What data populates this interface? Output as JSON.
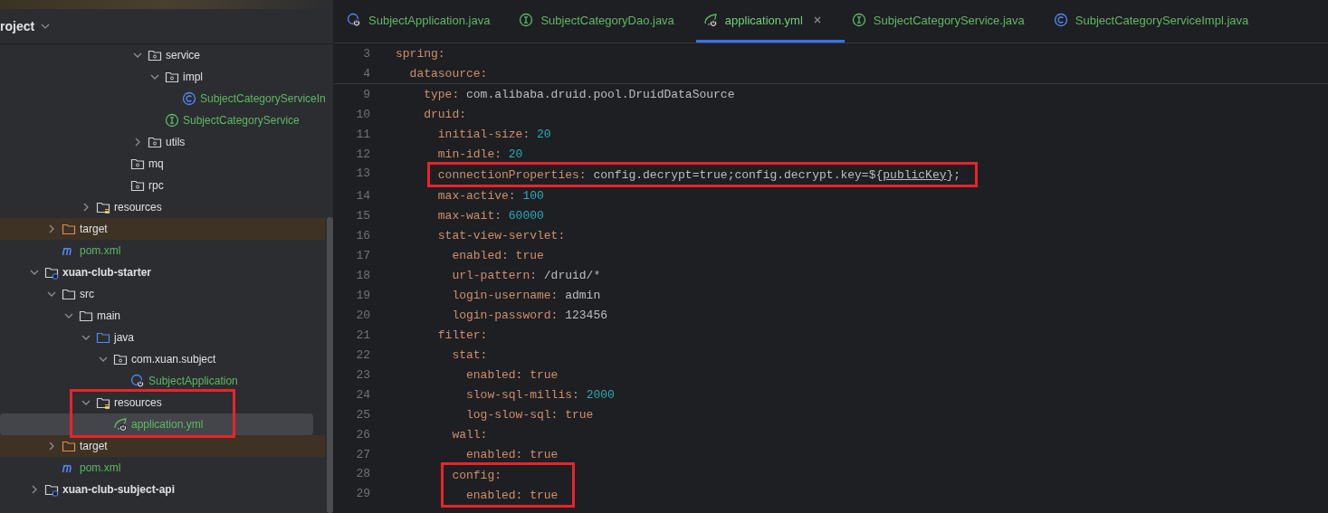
{
  "sidebar": {
    "title": "roject",
    "tree": [
      {
        "children": [
          {
            "children": [
              {
                "children": [
                  {
                    "children": [
                      {
                        "children": [
                          {
                            "children": [
                              {
                                "label": "service",
                                "kind": "package",
                                "expanded": true,
                                "selected": false,
                                "children": [
                                  {
                                    "label": "impl",
                                    "kind": "package",
                                    "expanded": true,
                                    "selected": false,
                                    "children": [
                                      {
                                        "label": "SubjectCategoryServiceIn",
                                        "kind": "class",
                                        "color": "#5fb865",
                                        "selected": false
                                      }
                                    ]
                                  },
                                  {
                                    "label": "SubjectCategoryService",
                                    "kind": "interface",
                                    "color": "#5fb865",
                                    "selected": false
                                  }
                                ]
                              },
                              {
                                "label": "utils",
                                "kind": "package",
                                "expanded": false,
                                "selected": false
                              }
                            ]
                          },
                          {
                            "label": "mq",
                            "kind": "package",
                            "selected": false
                          },
                          {
                            "label": "rpc",
                            "kind": "package",
                            "selected": false
                          }
                        ]
                      }
                    ]
                  },
                  {
                    "label": "resources",
                    "kind": "resources",
                    "expanded": false,
                    "selected": false
                  }
                ]
              }
            ]
          },
          {
            "label": "target",
            "kind": "excluded",
            "expanded": false,
            "selected": false
          },
          {
            "label": "pom.xml",
            "kind": "maven",
            "color": "#5fb865",
            "selected": false
          }
        ]
      },
      {
        "label": "xuan-club-starter",
        "kind": "module",
        "expanded": true,
        "selected": false,
        "children": [
          {
            "label": "src",
            "kind": "folder",
            "expanded": true,
            "selected": false,
            "children": [
              {
                "label": "main",
                "kind": "folder",
                "expanded": true,
                "selected": false,
                "children": [
                  {
                    "label": "java",
                    "kind": "source",
                    "expanded": true,
                    "selected": false,
                    "children": [
                      {
                        "label": "com.xuan.subject",
                        "kind": "package",
                        "expanded": true,
                        "selected": false,
                        "children": [
                          {
                            "label": "SubjectApplication",
                            "kind": "spring-app",
                            "color": "#5fb865",
                            "selected": false
                          }
                        ]
                      }
                    ]
                  },
                  {
                    "label": "resources",
                    "kind": "resources",
                    "expanded": true,
                    "selected": false,
                    "annotated": true,
                    "children": [
                      {
                        "label": "application.yml",
                        "kind": "yml",
                        "color": "#5fb865",
                        "selected": true,
                        "annotated": true
                      }
                    ]
                  }
                ]
              }
            ]
          },
          {
            "label": "target",
            "kind": "excluded",
            "expanded": false,
            "selected": false
          },
          {
            "label": "pom.xml",
            "kind": "maven",
            "color": "#5fb865",
            "selected": false
          }
        ]
      },
      {
        "label": "xuan-club-subject-api",
        "kind": "module",
        "expanded": false,
        "selected": false
      }
    ]
  },
  "tabs": [
    {
      "label": "SubjectApplication.java",
      "kind": "spring-app",
      "selected": false
    },
    {
      "label": "SubjectCategoryDao.java",
      "kind": "interface",
      "selected": false
    },
    {
      "label": "application.yml",
      "kind": "yml",
      "selected": true
    },
    {
      "label": "SubjectCategoryService.java",
      "kind": "interface",
      "selected": false
    },
    {
      "label": "SubjectCategoryServiceImpl.java",
      "kind": "class",
      "selected": false
    }
  ],
  "editor": {
    "lines": [
      {
        "number": "3",
        "key": "spring:",
        "sticky": true,
        "children": [
          {
            "number": "4",
            "key": "datasource:",
            "sticky": true,
            "children": [
              {
                "number": "9",
                "key": "type:",
                "value": [
                  {
                    "text": "com.alibaba.druid.pool.DruidDataSource",
                    "kind": "plain"
                  }
                ]
              },
              {
                "number": "10",
                "key": "druid:",
                "children": [
                  {
                    "number": "11",
                    "key": "initial-size:",
                    "value": [
                      {
                        "text": "20",
                        "kind": "number"
                      }
                    ]
                  },
                  {
                    "number": "12",
                    "key": "min-idle:",
                    "value": [
                      {
                        "text": "20",
                        "kind": "number"
                      }
                    ]
                  },
                  {
                    "number": "13",
                    "key": "connectionProperties:",
                    "annotated": true,
                    "value": [
                      {
                        "text": "config.decrypt=true;config.decrypt.key=${",
                        "kind": "plain"
                      },
                      {
                        "text": "publicKey",
                        "kind": "reference"
                      },
                      {
                        "text": "};",
                        "kind": "plain"
                      }
                    ]
                  },
                  {
                    "number": "14",
                    "key": "max-active:",
                    "value": [
                      {
                        "text": "100",
                        "kind": "number"
                      }
                    ]
                  },
                  {
                    "number": "15",
                    "key": "max-wait:",
                    "value": [
                      {
                        "text": "60000",
                        "kind": "number"
                      }
                    ]
                  },
                  {
                    "number": "16",
                    "key": "stat-view-servlet:",
                    "children": [
                      {
                        "number": "17",
                        "key": "enabled:",
                        "value": [
                          {
                            "text": "true",
                            "kind": "keyword"
                          }
                        ]
                      },
                      {
                        "number": "18",
                        "key": "url-pattern:",
                        "value": [
                          {
                            "text": "/druid/*",
                            "kind": "plain"
                          }
                        ]
                      },
                      {
                        "number": "19",
                        "key": "login-username:",
                        "value": [
                          {
                            "text": "admin",
                            "kind": "plain"
                          }
                        ]
                      },
                      {
                        "number": "20",
                        "key": "login-password:",
                        "value": [
                          {
                            "text": "123456",
                            "kind": "plain"
                          }
                        ]
                      }
                    ]
                  },
                  {
                    "number": "21",
                    "key": "filter:",
                    "children": [
                      {
                        "number": "22",
                        "key": "stat:",
                        "children": [
                          {
                            "number": "23",
                            "key": "enabled:",
                            "value": [
                              {
                                "text": "true",
                                "kind": "keyword"
                              }
                            ]
                          },
                          {
                            "number": "24",
                            "key": "slow-sql-millis:",
                            "value": [
                              {
                                "text": "2000",
                                "kind": "number"
                              }
                            ]
                          },
                          {
                            "number": "25",
                            "key": "log-slow-sql:",
                            "value": [
                              {
                                "text": "true",
                                "kind": "keyword"
                              }
                            ]
                          }
                        ]
                      },
                      {
                        "number": "26",
                        "key": "wall:",
                        "children": [
                          {
                            "number": "27",
                            "key": "enabled:",
                            "value": [
                              {
                                "text": "true",
                                "kind": "keyword"
                              }
                            ]
                          }
                        ]
                      },
                      {
                        "number": "28",
                        "key": "config:",
                        "annotated": true,
                        "children": [
                          {
                            "number": "29",
                            "key": "enabled:",
                            "annotated": true,
                            "value": [
                              {
                                "text": "true",
                                "kind": "keyword"
                              }
                            ]
                          }
                        ]
                      }
                    ]
                  }
                ]
              }
            ]
          }
        ]
      }
    ]
  }
}
